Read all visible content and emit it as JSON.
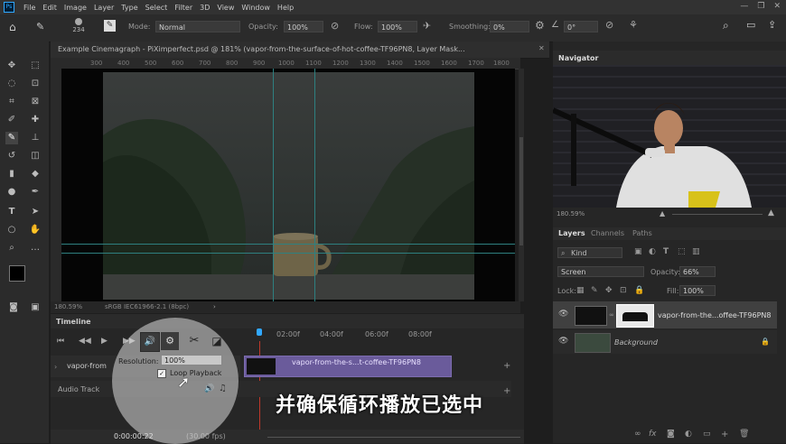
{
  "menu": {
    "logo": "Ps",
    "items": [
      "File",
      "Edit",
      "Image",
      "Layer",
      "Type",
      "Select",
      "Filter",
      "3D",
      "View",
      "Window",
      "Help"
    ]
  },
  "options": {
    "brush_size": "234",
    "mode_label": "Mode:",
    "mode_value": "Normal",
    "opacity_label": "Opacity:",
    "opacity_value": "100%",
    "flow_label": "Flow:",
    "flow_value": "100%",
    "smoothing_label": "Smoothing:",
    "smoothing_value": "0%",
    "angle_value": "0°"
  },
  "document": {
    "tab_title": "Example Cinemagraph - PiXimperfect.psd @ 181% (vapor-from-the-surface-of-hot-coffee-TF96PN8, Layer Mask...",
    "ruler_marks": [
      "300",
      "400",
      "500",
      "600",
      "700",
      "800",
      "900",
      "1000",
      "1100",
      "1200",
      "1300",
      "1400",
      "1500",
      "1600",
      "1700",
      "1800"
    ],
    "zoom": "180.59%",
    "profile": "sRGB IEC61966-2.1 (8bpc)"
  },
  "timeline": {
    "title": "Timeline",
    "time_marks": [
      "02:00f",
      "04:00f",
      "06:00f",
      "08:00f"
    ],
    "track_name": "vapor-from",
    "clip_label": "vapor-from-the-s...t-coffee-TF96PN8",
    "audio_track": "Audio Track",
    "current_time": "0:00:00:22",
    "fps": "(30.00 fps)"
  },
  "settings_popup": {
    "resolution_label": "Resolution:",
    "resolution_value": "100%",
    "loop_label": "Loop Playback",
    "loop_checked": true
  },
  "navigator": {
    "title": "Navigator",
    "zoom": "180.59%"
  },
  "layers_panel": {
    "tabs": [
      "Layers",
      "Channels",
      "Paths"
    ],
    "kind_label": "Kind",
    "blend_mode": "Screen",
    "opacity_label": "Opacity:",
    "opacity_value": "66%",
    "lock_label": "Lock:",
    "fill_label": "Fill:",
    "fill_value": "100%",
    "layers": [
      {
        "name": "vapor-from-the...offee-TF96PN8"
      },
      {
        "name": "Background"
      }
    ]
  },
  "subtitle": "并确保循环播放已选中",
  "colors": {
    "accent_blue": "#31a8ff",
    "clip_purple": "#5a4a86",
    "panel_dark": "#262626"
  }
}
